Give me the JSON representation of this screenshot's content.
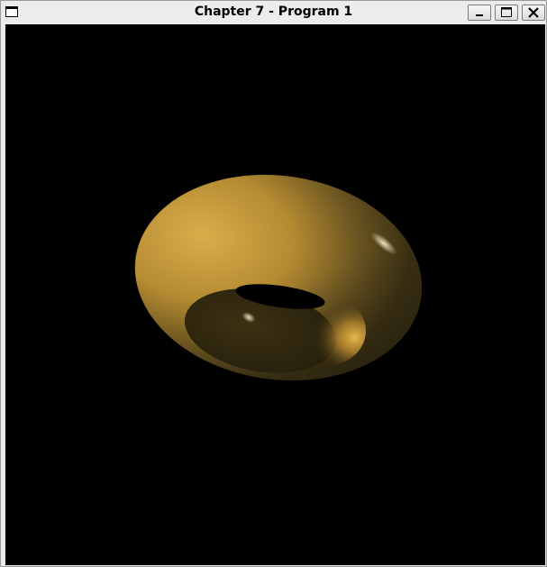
{
  "window": {
    "title": "Chapter 7 - Program 1"
  },
  "controls": {
    "minimize_icon": "minimize-icon",
    "maximize_icon": "maximize-icon",
    "close_icon": "close-icon"
  },
  "scene": {
    "background": "#000000",
    "object": "torus",
    "material_color": "#d4a640",
    "shadow_color": "#2e2710"
  }
}
